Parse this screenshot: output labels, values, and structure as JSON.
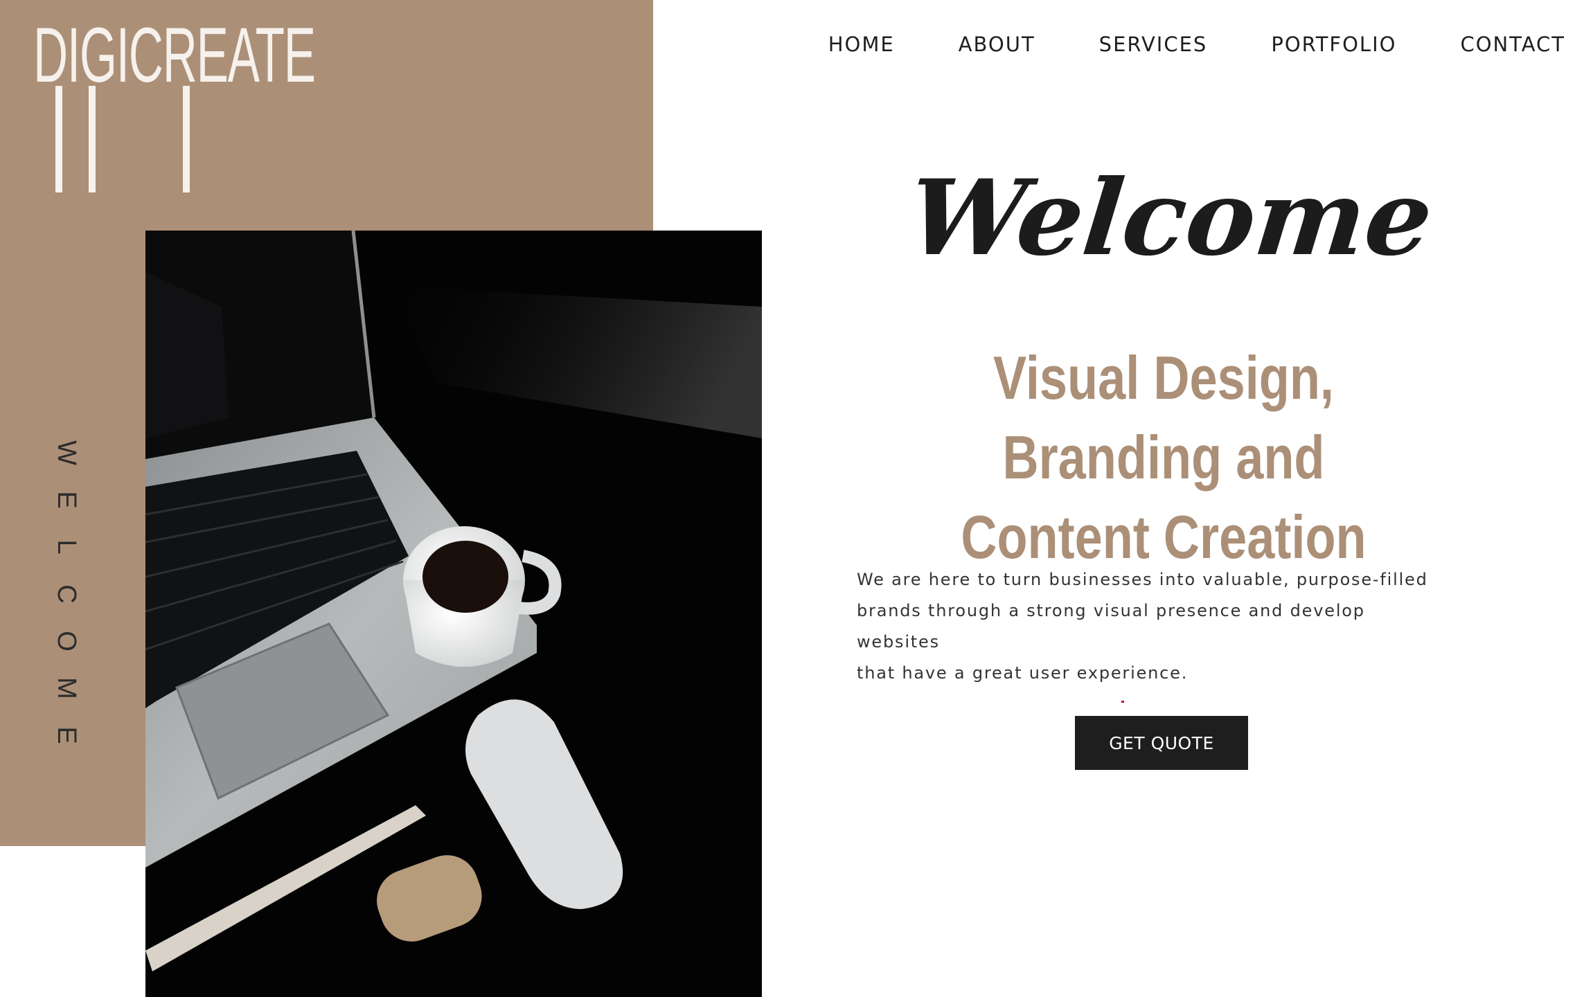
{
  "brand": {
    "logo_text": "DIGICREATE",
    "accent_color": "#ab8f77"
  },
  "sidebar": {
    "vertical_label": "WELCOME"
  },
  "nav": {
    "items": [
      {
        "label": "HOME"
      },
      {
        "label": "ABOUT"
      },
      {
        "label": "SERVICES"
      },
      {
        "label": "PORTFOLIO"
      },
      {
        "label": "CONTACT"
      }
    ]
  },
  "hero": {
    "script_title": "Welcome",
    "headline_line1": "Visual Design, Branding and",
    "headline_line2": "Content Creation",
    "body_line1": "We are here to turn businesses into valuable, purpose-filled",
    "body_line2": "brands through a strong visual presence and develop websites",
    "body_line3": "that have a great user experience.",
    "cta_label": "GET QUOTE"
  },
  "image": {
    "subject": "laptop-coffee-mouse-photo"
  }
}
